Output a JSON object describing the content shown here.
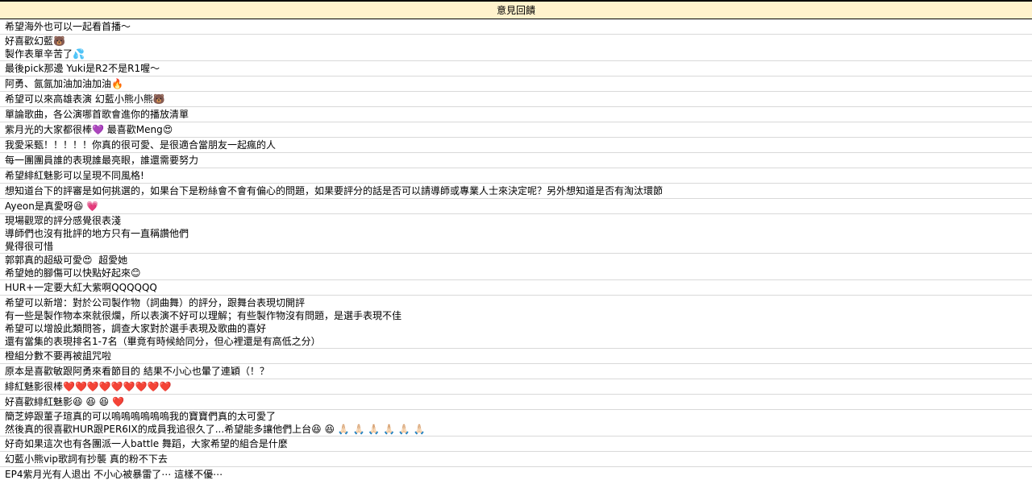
{
  "sheet": {
    "header": "意見回饋",
    "rows": [
      "希望海外也可以一起看首播～",
      "好喜歡幻藍🐻\n製作表單辛苦了💦",
      "最後pick那邊 Yuki是R2不是R1喔～",
      "阿勇、氤氤加油加油加油🔥",
      "希望可以來高雄表演 幻藍小熊小熊🐻",
      "單論歌曲，各公演哪首歌會進你的播放清單",
      "紫月光的大家都很棒💜 最喜歡Meng😍",
      "我愛采甄！！！！！你真的很可愛、是很適合當朋友一起瘋的人",
      "每一團團員誰的表現誰最亮眼，誰還需要努力",
      "希望緋紅魅影可以呈現不同風格!",
      "想知道台下的評審是如何挑選的，如果台下是粉絲會不會有偏心的問題，如果要評分的話是否可以請導師或專業人士來決定呢？另外想知道是否有淘汰環節",
      "Ayeon是真愛呀😆 💗",
      "現場觀眾的評分感覺很表淺\n導師們也沒有批評的地方只有一直稱讚他們\n覺得很可惜",
      "郭郭真的超級可愛😍  超愛她\n希望她的腳傷可以快點好起來😊",
      "HUR+一定要大紅大紫啊QQQQQQ",
      "希望可以新增：對於公司製作物（詞曲舞）的評分，跟舞台表現切開評\n有一些是製作物本來就很爛，所以表演不好可以理解；有些製作物沒有問題，是選手表現不佳\n希望可以增設此類問答，調查大家對於選手表現及歌曲的喜好\n還有當集的表現排名1-7名（畢竟有時候給同分，但心裡還是有高低之分）",
      "橙組分數不要再被詛咒啦",
      "原本是喜歡敏跟阿勇來看節目的 結果不小心也暈了連穎（！？",
      "緋紅魅影很棒❤️❤️❤️❤️❤️❤️❤️❤️❤️",
      "好喜歡緋紅魅影😆 😆 😆 ❤️",
      "簡芝婷跟董子瑄真的可以嗚嗚嗚嗚嗚嗚我的寶寶們真的太可愛了\n然後真的很喜歡HUR跟PER6IX的成員我追很久了...希望能多讓他們上台😆 😆 🙏🏻 🙏🏻 🙏🏻 🙏🏻 🙏🏻 🙏🏻",
      "好奇如果這次也有各團派一人battle 舞蹈，大家希望的組合是什麼",
      "幻藍小熊vip歌詞有抄襲 真的粉不下去",
      "EP4紫月光有人退出 不小心被暴雷了⋯ 這樣不優⋯"
    ]
  }
}
